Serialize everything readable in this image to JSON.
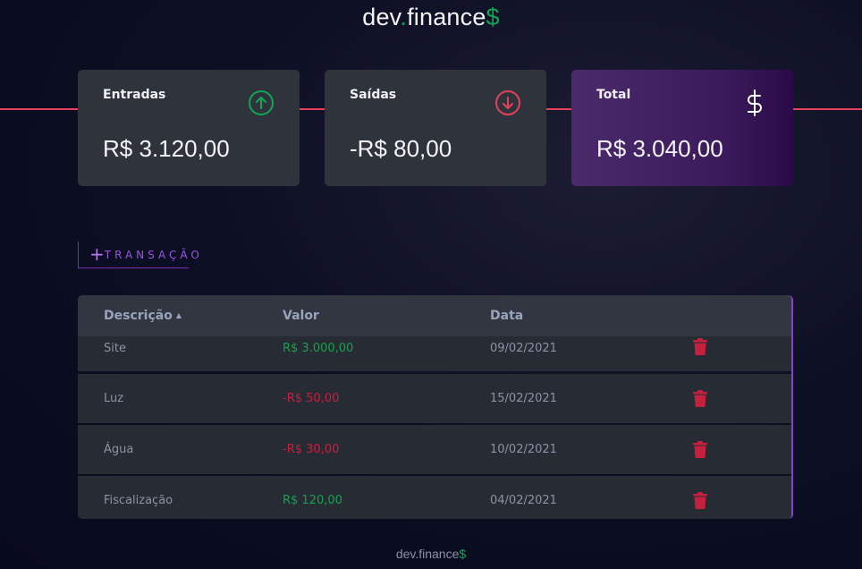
{
  "header": {
    "logo_main": "dev",
    "logo_dot": ".",
    "logo_rest": "finance",
    "logo_symbol": "$"
  },
  "cards": {
    "income": {
      "title": "Entradas",
      "value": "R$ 3.120,00",
      "icon": "arrow-up-circle-icon",
      "color": "#12a454"
    },
    "expense": {
      "title": "Saídas",
      "value": "-R$ 80,00",
      "icon": "arrow-down-circle-icon",
      "color": "#e83f5b"
    },
    "total": {
      "title": "Total",
      "value": "R$ 3.040,00",
      "icon": "dollar-sign-icon"
    }
  },
  "new_transaction": {
    "label": "TRANSAÇÃO",
    "icon": "plus-icon"
  },
  "table": {
    "headers": {
      "description": "Descrição",
      "value": "Valor",
      "date": "Data"
    },
    "sort_indicator": "▲",
    "rows": [
      {
        "description": "Site",
        "value": "R$ 3.000,00",
        "date": "09/02/2021",
        "type": "income"
      },
      {
        "description": "Luz",
        "value": "-R$ 50,00",
        "date": "15/02/2021",
        "type": "expense"
      },
      {
        "description": "Água",
        "value": "-R$ 30,00",
        "date": "10/02/2021",
        "type": "expense"
      },
      {
        "description": "Fiscalização",
        "value": "R$ 120,00",
        "date": "04/02/2021",
        "type": "income"
      }
    ]
  },
  "footer": {
    "logo_main": "dev.finance",
    "logo_symbol": "$"
  }
}
